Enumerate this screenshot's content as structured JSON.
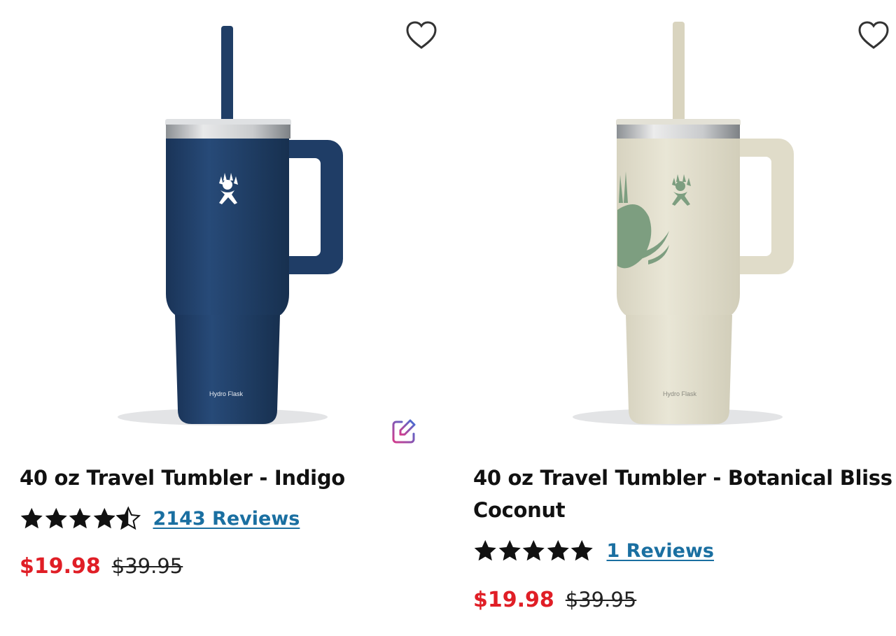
{
  "products": [
    {
      "title": "40 oz Travel Tumbler - Indigo",
      "brand_mark": "Hydro Flask",
      "rating": 4.5,
      "reviews": "2143 Reviews",
      "sale_price": "$19.98",
      "original_price": "$39.95",
      "body_color": "#1f3c64",
      "wishlist_icon": "heart-outline-icon"
    },
    {
      "title": "40 oz Travel Tumbler - Botanical Bliss Coconut",
      "brand_mark": "Hydro Flask",
      "rating": 5,
      "reviews": "1 Reviews",
      "sale_price": "$19.98",
      "original_price": "$39.95",
      "body_color": "#e3dfce",
      "wishlist_icon": "heart-outline-icon"
    }
  ],
  "colors": {
    "sale": "#e01e26",
    "link": "#1a6fa1",
    "star": "#111111"
  }
}
